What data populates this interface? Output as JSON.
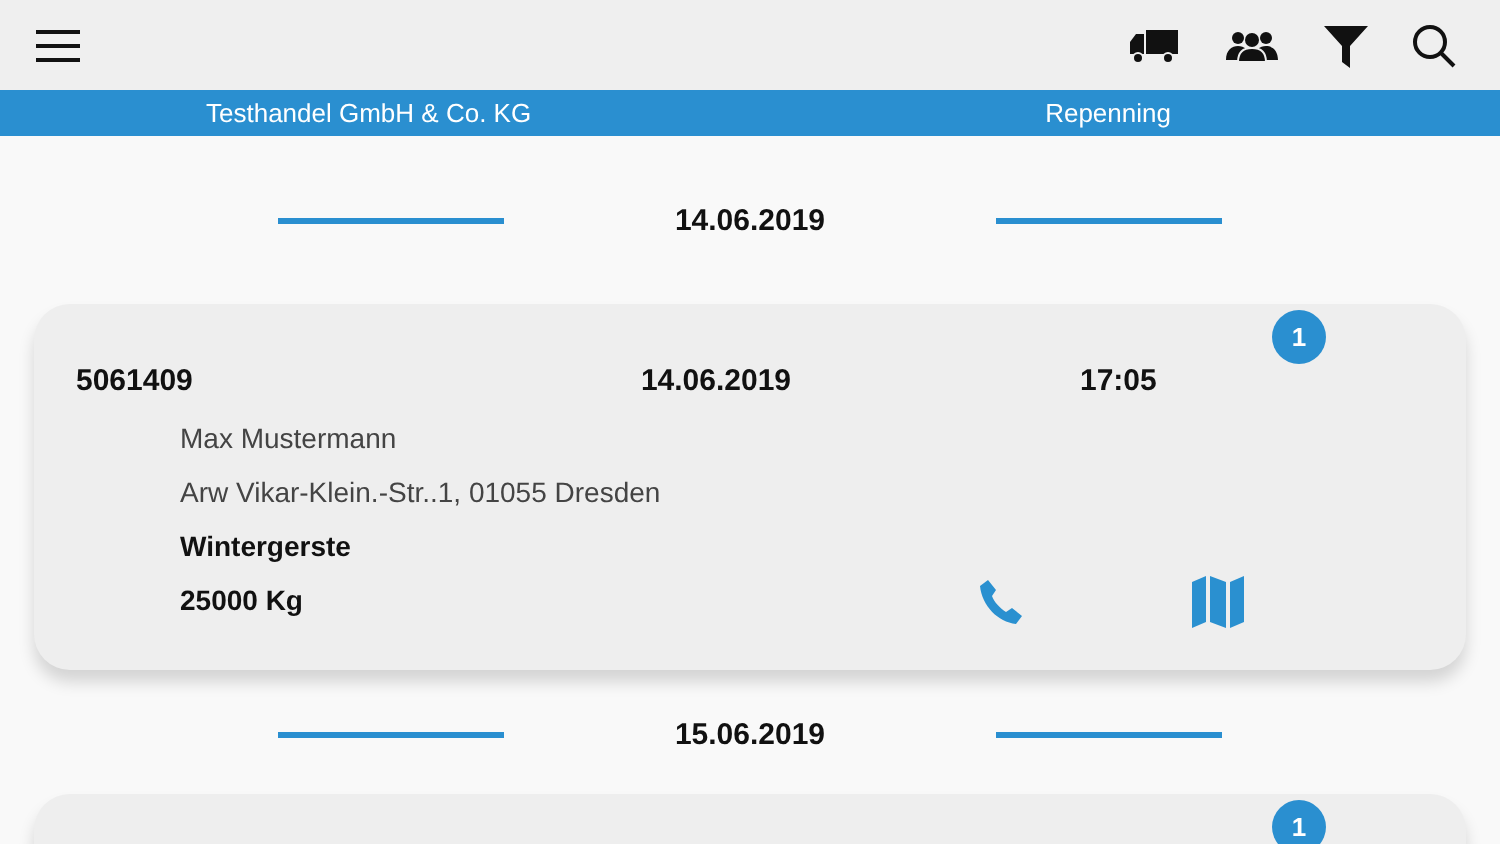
{
  "header": {
    "company": "Testhandel GmbH & Co. KG",
    "user": "Repenning"
  },
  "groups": [
    {
      "date": "14.06.2019",
      "orders": [
        {
          "number": "5061409",
          "date": "14.06.2019",
          "time": "17:05",
          "badge": "1",
          "name": "Max Mustermann",
          "address": "Arw Vikar-Klein.-Str..1, 01055 Dresden",
          "product": "Wintergerste",
          "weight": "25000 Kg"
        }
      ]
    },
    {
      "date": "15.06.2019",
      "orders": [
        {
          "badge": "1"
        }
      ]
    }
  ]
}
